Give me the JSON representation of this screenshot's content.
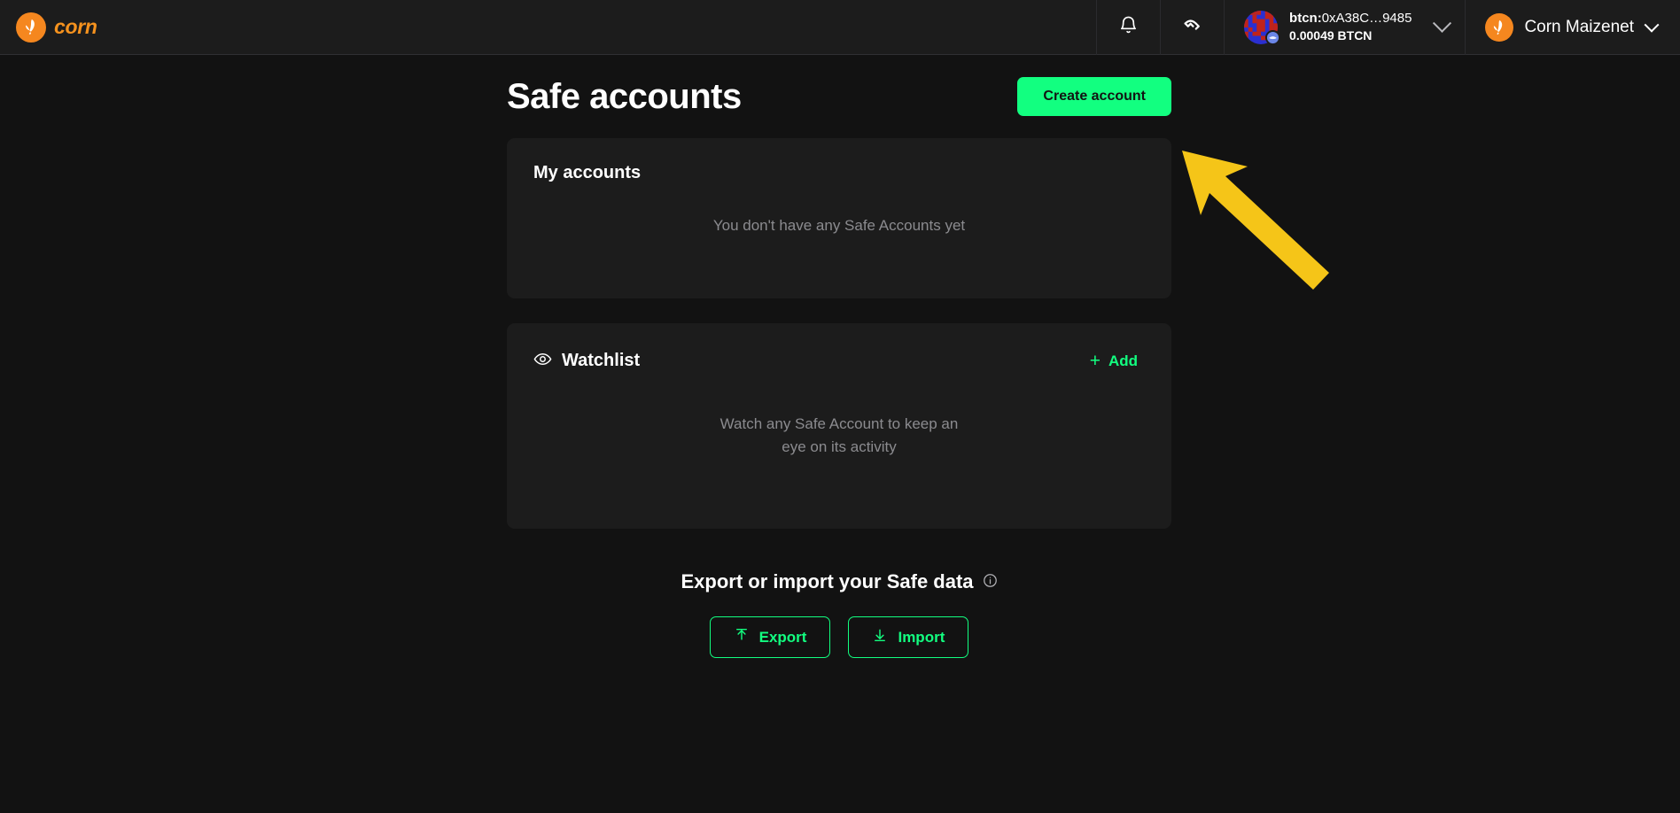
{
  "header": {
    "logo_text": "corn",
    "logo_icon": "corn-cob-icon",
    "notifications_icon": "bell-icon",
    "walletconnect_icon": "walletconnect-icon",
    "wallet": {
      "address_prefix": "btcn:",
      "address": "0xA38C…9485",
      "balance": "0.00049 BTCN",
      "avatar_icon": "blockies-avatar",
      "chain_badge_icon": "chain-badge-icon",
      "chevron_icon": "chevron-down-icon"
    },
    "network": {
      "label": "Corn Maizenet",
      "icon": "corn-cob-icon",
      "chevron_icon": "chevron-down-icon"
    }
  },
  "main": {
    "page_title": "Safe accounts",
    "create_account_label": "Create account",
    "my_accounts": {
      "title": "My accounts",
      "empty_message": "You don't have any Safe Accounts yet"
    },
    "watchlist": {
      "title": "Watchlist",
      "icon": "eye-icon",
      "add_label": "Add",
      "add_icon": "plus-icon",
      "empty_message": "Watch any Safe Account to keep an eye on its activity"
    },
    "export_import": {
      "title": "Export or import your Safe data",
      "info_icon": "info-circle-icon",
      "export_label": "Export",
      "export_icon": "arrow-up-tray-icon",
      "import_label": "Import",
      "import_icon": "arrow-down-tray-icon"
    }
  },
  "annotation": {
    "arrow_icon": "pointer-arrow-icon",
    "arrow_color": "#F5C518",
    "points_at": "create-account-button"
  },
  "colors": {
    "page_background": "#121212",
    "surface": "#1c1c1c",
    "accent_green": "#12FF80",
    "brand_orange": "#F5871F",
    "muted_text": "#8b8b8f"
  }
}
